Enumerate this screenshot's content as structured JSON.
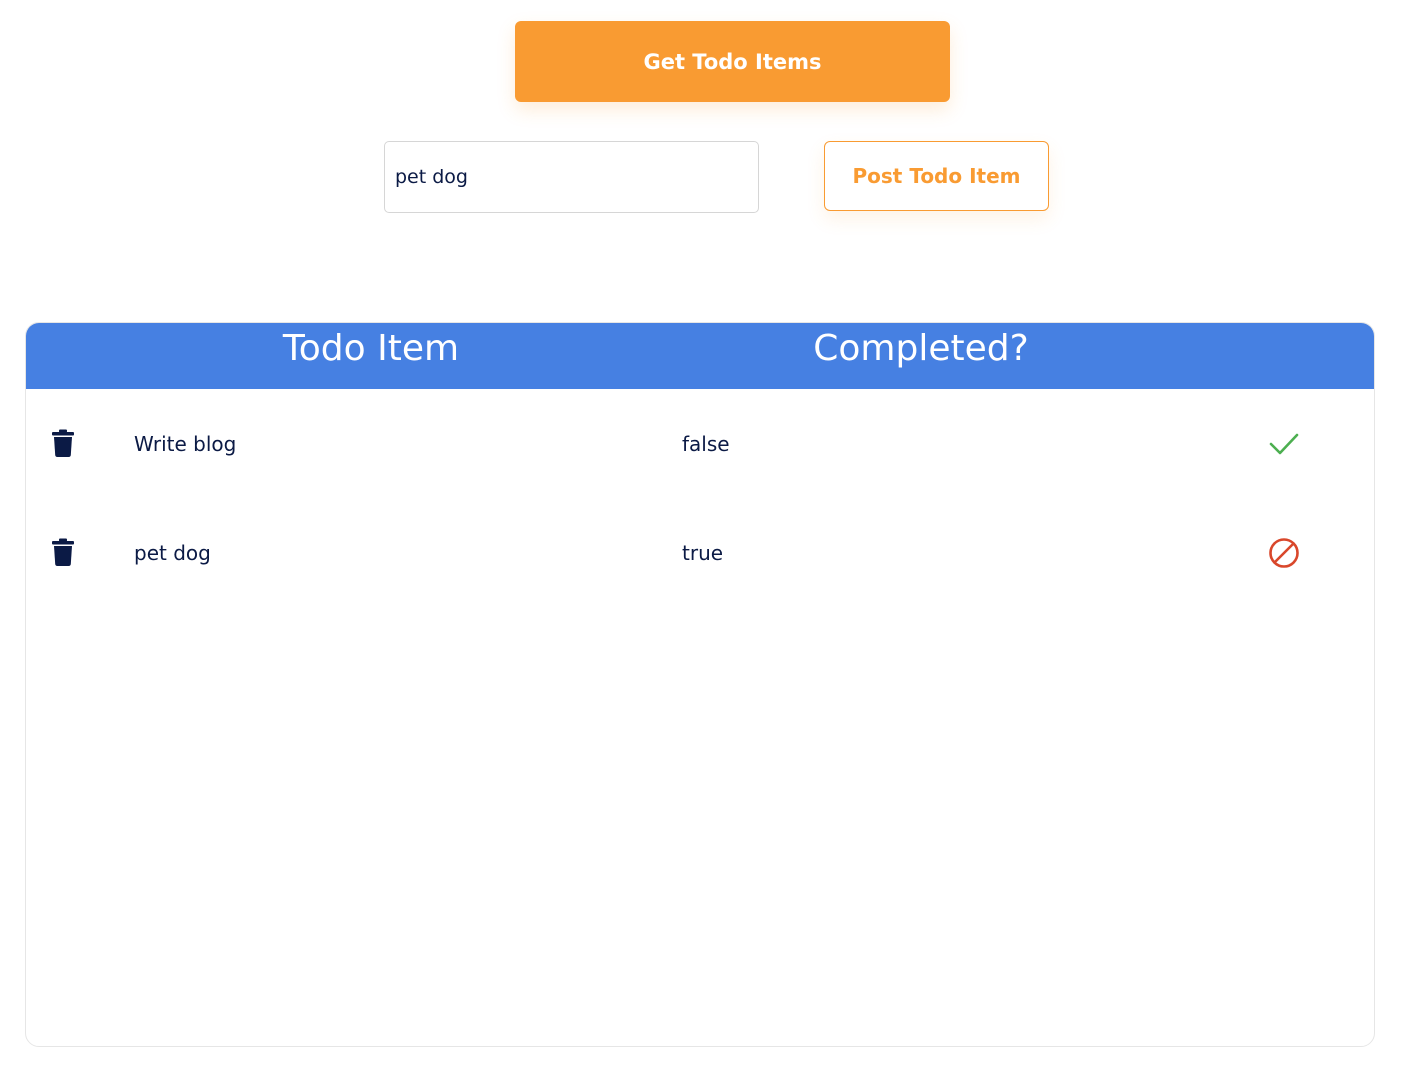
{
  "toolbar": {
    "get_button_label": "Get Todo Items",
    "post_button_label": "Post Todo Item"
  },
  "input": {
    "value": "pet dog",
    "placeholder": ""
  },
  "table": {
    "columns": [
      "Todo Item",
      "Completed?"
    ],
    "rows": [
      {
        "item": "Write blog",
        "completed": "false",
        "action_icon": "checkmark-icon"
      },
      {
        "item": "pet dog",
        "completed": "true",
        "action_icon": "prohibited-icon"
      }
    ]
  },
  "colors": {
    "accent_orange": "#f99b32",
    "header_blue": "#4680e2",
    "text_navy": "#0b1a45",
    "check_green": "#4caf50",
    "prohibit_red": "#d9472b"
  }
}
